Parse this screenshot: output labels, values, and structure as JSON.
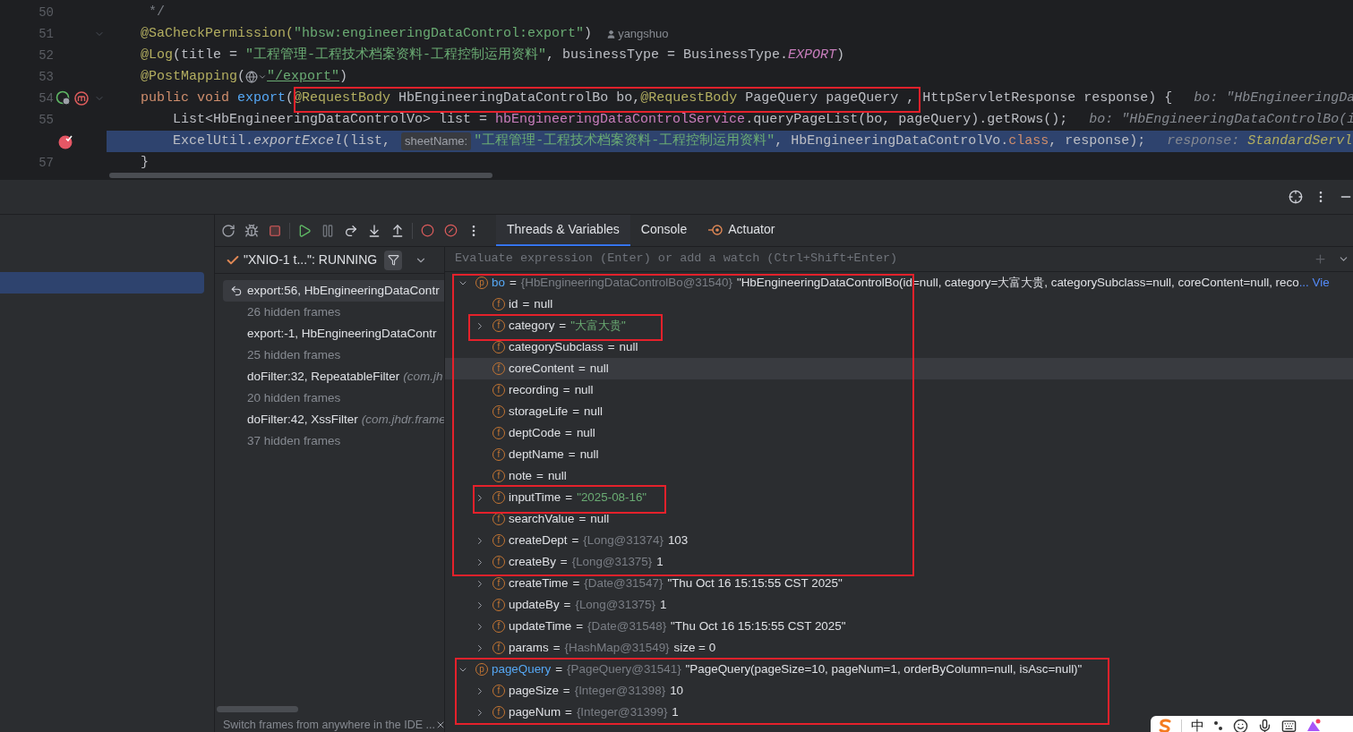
{
  "editor": {
    "lines": [
      {
        "number": "50",
        "foldable": false,
        "breakpoint": false,
        "gutter_markers": false,
        "current": false,
        "segments": [
          {
            "kind": "comment",
            "text": "     */"
          }
        ]
      },
      {
        "number": "51",
        "foldable": true,
        "breakpoint": false,
        "gutter_markers": false,
        "current": false,
        "segments": [
          {
            "kind": "annotation",
            "text": "    @SaCheckPermission("
          },
          {
            "kind": "string",
            "text": "\"hbsw:engineeringDataControl:export\""
          },
          {
            "kind": "plain",
            "text": ")"
          },
          {
            "kind": "author",
            "text": "yangshuo"
          }
        ]
      },
      {
        "number": "52",
        "foldable": false,
        "breakpoint": false,
        "gutter_markers": false,
        "current": false,
        "segments": [
          {
            "kind": "annotation",
            "text": "    @Log"
          },
          {
            "kind": "plain",
            "text": "(title = "
          },
          {
            "kind": "string",
            "text": "\"工程管理-工程技术档案资料-工程控制运用资料\""
          },
          {
            "kind": "plain",
            "text": ", businessType = BusinessType."
          },
          {
            "kind": "constant",
            "text": "EXPORT"
          },
          {
            "kind": "plain",
            "text": ")"
          }
        ]
      },
      {
        "number": "53",
        "foldable": false,
        "breakpoint": false,
        "gutter_markers": false,
        "current": false,
        "segments": [
          {
            "kind": "annotation",
            "text": "    @PostMapping"
          },
          {
            "kind": "plain",
            "text": "("
          },
          {
            "kind": "web"
          },
          {
            "kind": "url",
            "text": "\"/export\""
          },
          {
            "kind": "plain",
            "text": ")"
          }
        ]
      },
      {
        "number": "54",
        "foldable": true,
        "breakpoint": false,
        "gutter_markers": true,
        "current": false,
        "segments": [
          {
            "kind": "keyword",
            "text": "    public void "
          },
          {
            "kind": "method",
            "text": "export"
          },
          {
            "kind": "plain",
            "text": "("
          },
          {
            "kind": "annotation",
            "text": "@RequestBody"
          },
          {
            "kind": "plain",
            "text": " HbEngineeringDataControlBo bo,"
          },
          {
            "kind": "annotation",
            "text": "@RequestBody"
          },
          {
            "kind": "plain",
            "text": " PageQuery pageQuery , HttpServletResponse response) {"
          },
          {
            "kind": "debug_hint",
            "text": "bo: \"HbEngineeringDa"
          }
        ]
      },
      {
        "number": "55",
        "foldable": false,
        "breakpoint": false,
        "gutter_markers": false,
        "current": false,
        "segments": [
          {
            "kind": "plain",
            "text": "        List<HbEngineeringDataControlVo> list = "
          },
          {
            "kind": "field",
            "text": "hbEngineeringDataControlService"
          },
          {
            "kind": "plain",
            "text": ".queryPageList(bo, pageQuery).getRows();"
          },
          {
            "kind": "debug_hint",
            "text": "bo: \"HbEngineeringDataControlBo(i"
          }
        ]
      },
      {
        "breakpoint": true,
        "foldable": false,
        "gutter_markers": false,
        "current": true,
        "segments": [
          {
            "kind": "plain",
            "text": "        ExcelUtil."
          },
          {
            "kind": "static",
            "text": "exportExcel"
          },
          {
            "kind": "plain",
            "text": "(list, "
          },
          {
            "kind": "param_hint",
            "text": "sheetName:"
          },
          {
            "kind": "string",
            "text": "\"工程管理-工程技术档案资料-工程控制运用资料\""
          },
          {
            "kind": "plain",
            "text": ", HbEngineeringDataControlVo."
          },
          {
            "kind": "keyword",
            "text": "class"
          },
          {
            "kind": "plain",
            "text": ", response);"
          },
          {
            "kind": "debug_hint",
            "text": "response:"
          },
          {
            "kind": "debug_type",
            "text": "StandardServl"
          }
        ]
      },
      {
        "number": "57",
        "foldable": false,
        "breakpoint": false,
        "gutter_markers": false,
        "current": false,
        "segments": [
          {
            "kind": "plain",
            "text": "    }"
          }
        ]
      }
    ]
  },
  "sidebar": {
    "items": [
      {
        "selected": true
      }
    ]
  },
  "debugger": {
    "tabs": [
      {
        "label": "Threads & Variables",
        "kind": "plain",
        "selected": true
      },
      {
        "label": "Console",
        "kind": "plain",
        "selected": false
      },
      {
        "label": "Actuator",
        "kind": "actuator",
        "selected": false
      }
    ]
  },
  "frames": {
    "thread": "\"XNIO-1 t...\": RUNNING",
    "items": [
      {
        "kind": "frame",
        "text": "export:56, HbEngineeringDataContr",
        "selected": true
      },
      {
        "kind": "hidden",
        "text": "26 hidden frames",
        "selected": false
      },
      {
        "kind": "frame",
        "text": "export:-1, HbEngineeringDataContr",
        "selected": false
      },
      {
        "kind": "hidden",
        "text": "25 hidden frames",
        "selected": false
      },
      {
        "kind": "frame",
        "text": "doFilter:32, RepeatableFilter",
        "package": "(com.jh",
        "selected": false
      },
      {
        "kind": "hidden",
        "text": "20 hidden frames",
        "selected": false
      },
      {
        "kind": "frame",
        "text": "doFilter:42, XssFilter",
        "package": "(com.jhdr.frame",
        "selected": false
      },
      {
        "kind": "hidden",
        "text": "37 hidden frames",
        "selected": false
      }
    ],
    "hint": "Switch frames from anywhere in the IDE ..."
  },
  "variables": {
    "placeholder": "Evaluate expression (Enter) or add a watch (Ctrl+Shift+Enter)",
    "tree": [
      {
        "kind": "parameter",
        "badge": "p",
        "name": "bo",
        "op": "=",
        "type": "{HbEngineeringDataControlBo@31540}",
        "value": "\"HbEngineeringDataControlBo(id=null, category=大富大贵, categorySubclass=null, coreContent=null, reco",
        "string": false,
        "link": "... Vie",
        "expanded": true,
        "selected": false,
        "children": [
          {
            "kind": "field",
            "badge": "f",
            "name": "id",
            "op": "=",
            "value": "null",
            "string": false,
            "selected": false
          },
          {
            "kind": "field",
            "badge": "f",
            "name": "category",
            "op": "=",
            "value": "\"大富大贵\"",
            "string": true,
            "expanded": false,
            "selected": false
          },
          {
            "kind": "field",
            "badge": "f",
            "name": "categorySubclass",
            "op": "=",
            "value": "null",
            "string": false,
            "selected": false
          },
          {
            "kind": "field",
            "badge": "f",
            "name": "coreContent",
            "op": "=",
            "value": "null",
            "string": false,
            "selected": true
          },
          {
            "kind": "field",
            "badge": "f",
            "name": "recording",
            "op": "=",
            "value": "null",
            "string": false,
            "selected": false
          },
          {
            "kind": "field",
            "badge": "f",
            "name": "storageLife",
            "op": "=",
            "value": "null",
            "string": false,
            "selected": false
          },
          {
            "kind": "field",
            "badge": "f",
            "name": "deptCode",
            "op": "=",
            "value": "null",
            "string": false,
            "selected": false
          },
          {
            "kind": "field",
            "badge": "f",
            "name": "deptName",
            "op": "=",
            "value": "null",
            "string": false,
            "selected": false
          },
          {
            "kind": "field",
            "badge": "f",
            "name": "note",
            "op": "=",
            "value": "null",
            "string": false,
            "selected": false
          },
          {
            "kind": "field",
            "badge": "f",
            "name": "inputTime",
            "op": "=",
            "value": "\"2025-08-16\"",
            "string": true,
            "expanded": false,
            "selected": false
          },
          {
            "kind": "field",
            "badge": "f",
            "name": "searchValue",
            "op": "=",
            "value": "null",
            "string": false,
            "selected": false
          },
          {
            "kind": "field",
            "badge": "f",
            "name": "createDept",
            "op": "=",
            "type": "{Long@31374}",
            "value": "103",
            "string": false,
            "expanded": false,
            "selected": false
          },
          {
            "kind": "field",
            "badge": "f",
            "name": "createBy",
            "op": "=",
            "type": "{Long@31375}",
            "value": "1",
            "string": false,
            "expanded": false,
            "selected": false
          },
          {
            "kind": "field",
            "badge": "f",
            "name": "createTime",
            "op": "=",
            "type": "{Date@31547}",
            "value": "\"Thu Oct 16 15:15:55 CST 2025\"",
            "string": false,
            "expanded": false,
            "selected": false
          },
          {
            "kind": "field",
            "badge": "f",
            "name": "updateBy",
            "op": "=",
            "type": "{Long@31375}",
            "value": "1",
            "string": false,
            "expanded": false,
            "selected": false
          },
          {
            "kind": "field",
            "badge": "f",
            "name": "updateTime",
            "op": "=",
            "type": "{Date@31548}",
            "value": "\"Thu Oct 16 15:15:55 CST 2025\"",
            "string": false,
            "expanded": false,
            "selected": false
          },
          {
            "kind": "field",
            "badge": "f",
            "name": "params",
            "op": "=",
            "type": "{HashMap@31549}",
            "value": "size = 0",
            "string": false,
            "expanded": false,
            "selected": false
          }
        ]
      },
      {
        "kind": "parameter",
        "badge": "p",
        "name": "pageQuery",
        "op": "=",
        "type": "{PageQuery@31541}",
        "value": "\"PageQuery(pageSize=10, pageNum=1, orderByColumn=null, isAsc=null)\"",
        "string": false,
        "expanded": true,
        "selected": false,
        "children": [
          {
            "kind": "field",
            "badge": "f",
            "name": "pageSize",
            "op": "=",
            "type": "{Integer@31398}",
            "value": "10",
            "string": false,
            "expanded": false,
            "selected": false
          },
          {
            "kind": "field",
            "badge": "f",
            "name": "pageNum",
            "op": "=",
            "type": "{Integer@31399}",
            "value": "1",
            "string": false,
            "expanded": false,
            "selected": false
          }
        ]
      }
    ]
  },
  "ime_bar": {
    "label": "中"
  }
}
